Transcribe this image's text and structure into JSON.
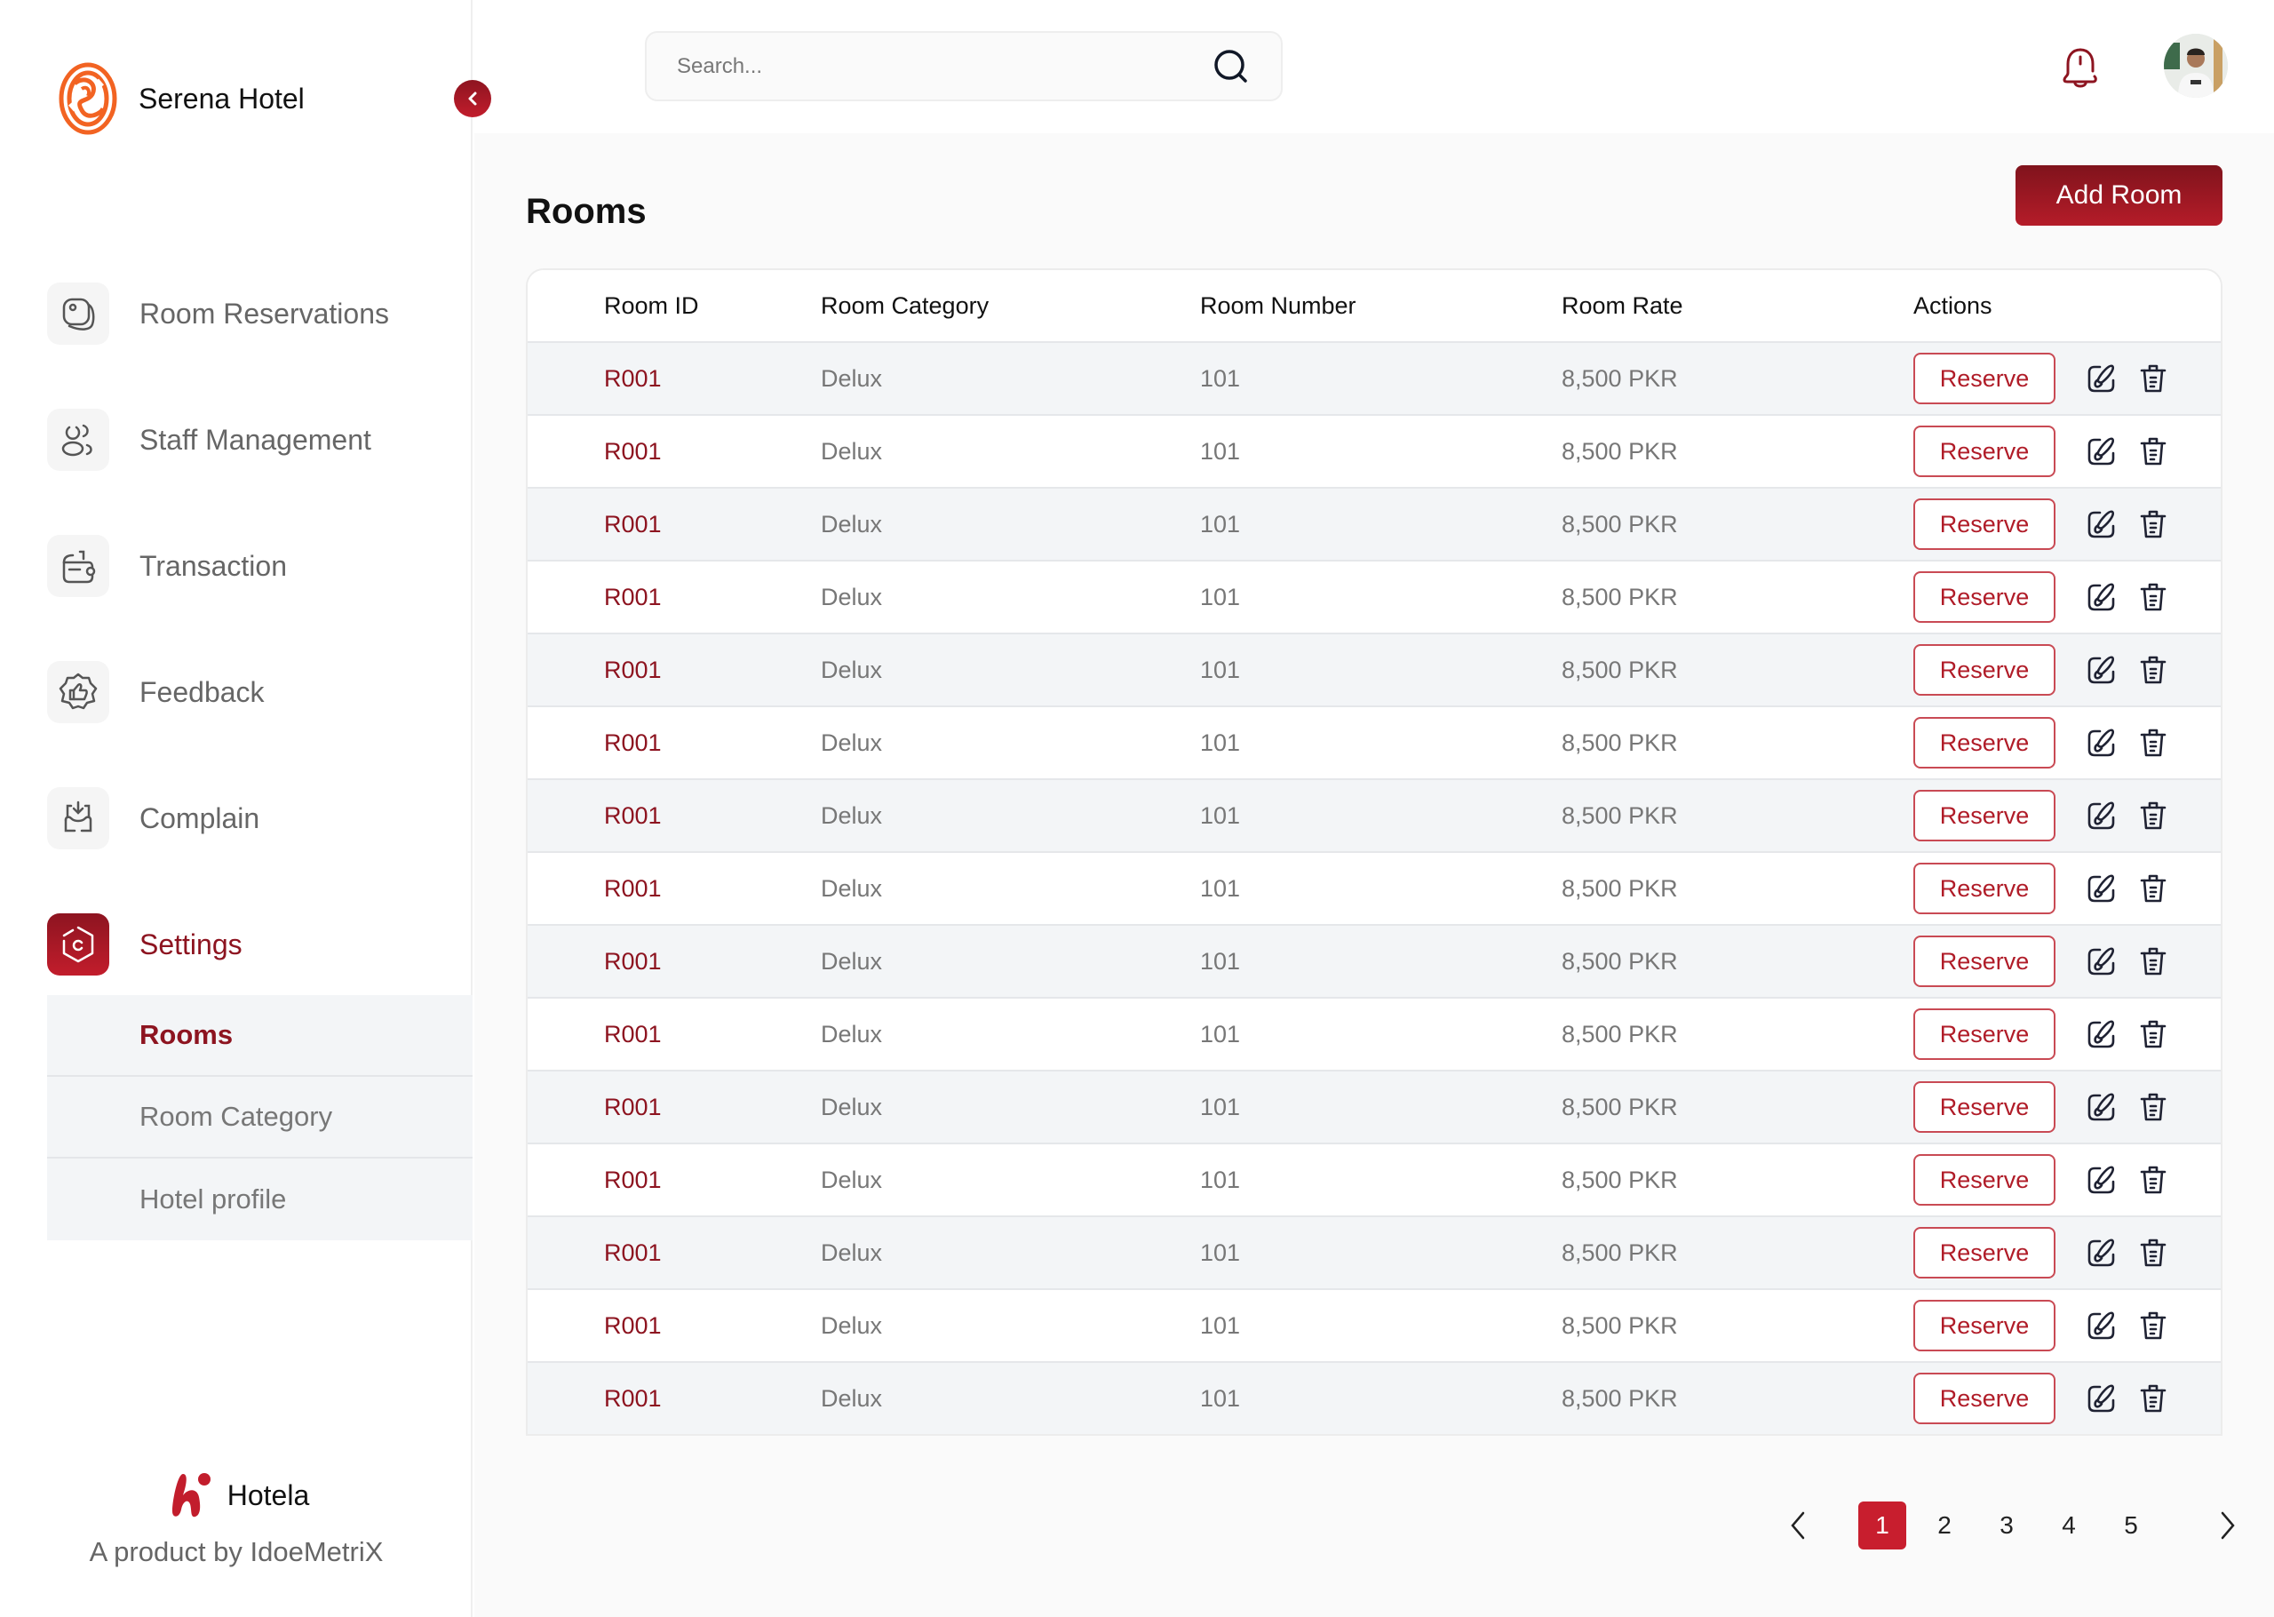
{
  "brand": {
    "name": "Serena Hotel",
    "logo_icon": "serena-logo-icon"
  },
  "sidebar": {
    "collapse_icon": "chevron-left-icon",
    "items": [
      {
        "label": "Room Reservations",
        "icon": "room-card-icon",
        "active": false
      },
      {
        "label": "Staff Management",
        "icon": "users-icon",
        "active": false
      },
      {
        "label": "Transaction",
        "icon": "wallet-icon",
        "active": false
      },
      {
        "label": "Feedback",
        "icon": "thumbs-up-badge-icon",
        "active": false
      },
      {
        "label": "Complain",
        "icon": "inbox-download-icon",
        "active": false
      },
      {
        "label": "Settings",
        "icon": "settings-hexagon-icon",
        "active": true
      }
    ],
    "subitems": [
      {
        "label": "Rooms",
        "active": true
      },
      {
        "label": "Room Category",
        "active": false
      },
      {
        "label": "Hotel profile",
        "active": false
      }
    ],
    "footer": {
      "name": "Hotela",
      "tagline": "A product by IdoeMetriX"
    }
  },
  "header": {
    "search_placeholder": "Search...",
    "search_value": "",
    "search_icon": "search-icon",
    "notification_icon": "bell-icon",
    "avatar": "user-avatar"
  },
  "main": {
    "title": "Rooms",
    "add_button": "Add Room",
    "table": {
      "columns": [
        "Room ID",
        "Room Category",
        "Room Number",
        "Room Rate",
        "Actions"
      ],
      "reserve_label": "Reserve",
      "rows": [
        {
          "id": "R001",
          "category": "Delux",
          "number": "101",
          "rate": "8,500 PKR"
        },
        {
          "id": "R001",
          "category": "Delux",
          "number": "101",
          "rate": "8,500 PKR"
        },
        {
          "id": "R001",
          "category": "Delux",
          "number": "101",
          "rate": "8,500 PKR"
        },
        {
          "id": "R001",
          "category": "Delux",
          "number": "101",
          "rate": "8,500 PKR"
        },
        {
          "id": "R001",
          "category": "Delux",
          "number": "101",
          "rate": "8,500 PKR"
        },
        {
          "id": "R001",
          "category": "Delux",
          "number": "101",
          "rate": "8,500 PKR"
        },
        {
          "id": "R001",
          "category": "Delux",
          "number": "101",
          "rate": "8,500 PKR"
        },
        {
          "id": "R001",
          "category": "Delux",
          "number": "101",
          "rate": "8,500 PKR"
        },
        {
          "id": "R001",
          "category": "Delux",
          "number": "101",
          "rate": "8,500 PKR"
        },
        {
          "id": "R001",
          "category": "Delux",
          "number": "101",
          "rate": "8,500 PKR"
        },
        {
          "id": "R001",
          "category": "Delux",
          "number": "101",
          "rate": "8,500 PKR"
        },
        {
          "id": "R001",
          "category": "Delux",
          "number": "101",
          "rate": "8,500 PKR"
        },
        {
          "id": "R001",
          "category": "Delux",
          "number": "101",
          "rate": "8,500 PKR"
        },
        {
          "id": "R001",
          "category": "Delux",
          "number": "101",
          "rate": "8,500 PKR"
        },
        {
          "id": "R001",
          "category": "Delux",
          "number": "101",
          "rate": "8,500 PKR"
        }
      ]
    },
    "pagination": {
      "pages": [
        "1",
        "2",
        "3",
        "4",
        "5"
      ],
      "current": "1"
    }
  },
  "colors": {
    "accent": "#8d1420",
    "accent_bright": "#c81e2e",
    "logo_orange": "#f26322",
    "muted_text": "#777777"
  }
}
